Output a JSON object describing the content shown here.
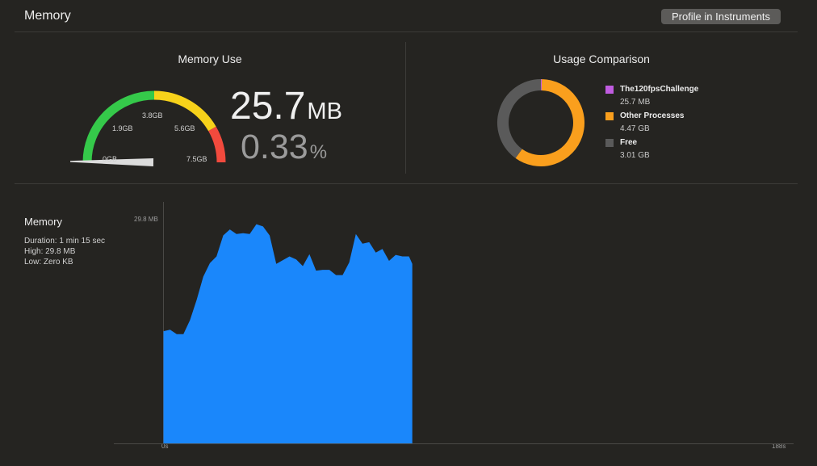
{
  "header": {
    "title": "Memory",
    "profile_button_label": "Profile in Instruments"
  },
  "memory_use": {
    "title": "Memory Use",
    "gauge_labels": [
      "0GB",
      "1.9GB",
      "3.8GB",
      "5.6GB",
      "7.5GB"
    ],
    "gauge_max_gb": 7.5,
    "needle_value_gb": 0.0257,
    "value_number": "25.7",
    "value_unit": "MB",
    "percent_number": "0.33",
    "percent_unit": "%",
    "colors": {
      "green": "#35c94a",
      "yellow": "#f7d21a",
      "red": "#f24a3d"
    }
  },
  "usage_comparison": {
    "title": "Usage Comparison",
    "legend": [
      {
        "name": "The120fpsChallenge",
        "value": "25.7 MB",
        "color": "#c05ce0",
        "gb": 0.0257
      },
      {
        "name": "Other Processes",
        "value": "4.47 GB",
        "color": "#fa9f1d",
        "gb": 4.47
      },
      {
        "name": "Free",
        "value": "3.01 GB",
        "color": "#5a5a5a",
        "gb": 3.01
      }
    ]
  },
  "graph": {
    "title": "Memory",
    "duration": "Duration: 1 min 15 sec",
    "high": "High: 29.8 MB",
    "low": "Low: Zero KB",
    "y_max_label": "29.8 MB",
    "x_start_label": "0s",
    "x_end_label": "188s",
    "color": "#1a87fb"
  },
  "chart_data": {
    "type": "area",
    "x": [
      0,
      2,
      4,
      6,
      8,
      10,
      12,
      14,
      16,
      18,
      20,
      22,
      24,
      26,
      28,
      30,
      32,
      34,
      36,
      38,
      40,
      42,
      44,
      46,
      48,
      50,
      52,
      54,
      56,
      58,
      60,
      62,
      64,
      66,
      68,
      70,
      72,
      74,
      75
    ],
    "values": [
      15.0,
      15.2,
      14.6,
      14.6,
      16.5,
      19.2,
      22.3,
      24.1,
      25.0,
      27.8,
      28.6,
      28.0,
      28.1,
      28.0,
      29.3,
      29.0,
      27.8,
      24.0,
      24.5,
      25.0,
      24.6,
      23.7,
      25.3,
      23.1,
      23.2,
      23.2,
      22.5,
      22.5,
      24.2,
      28.0,
      26.7,
      26.9,
      25.5,
      26.0,
      24.4,
      25.2,
      25.0,
      25.0,
      24.0
    ],
    "title": "Memory",
    "xlabel": "",
    "ylabel": "",
    "xlim": [
      0,
      188
    ],
    "ylim": [
      0,
      29.8
    ],
    "x_unit": "s",
    "y_unit": "MB"
  }
}
